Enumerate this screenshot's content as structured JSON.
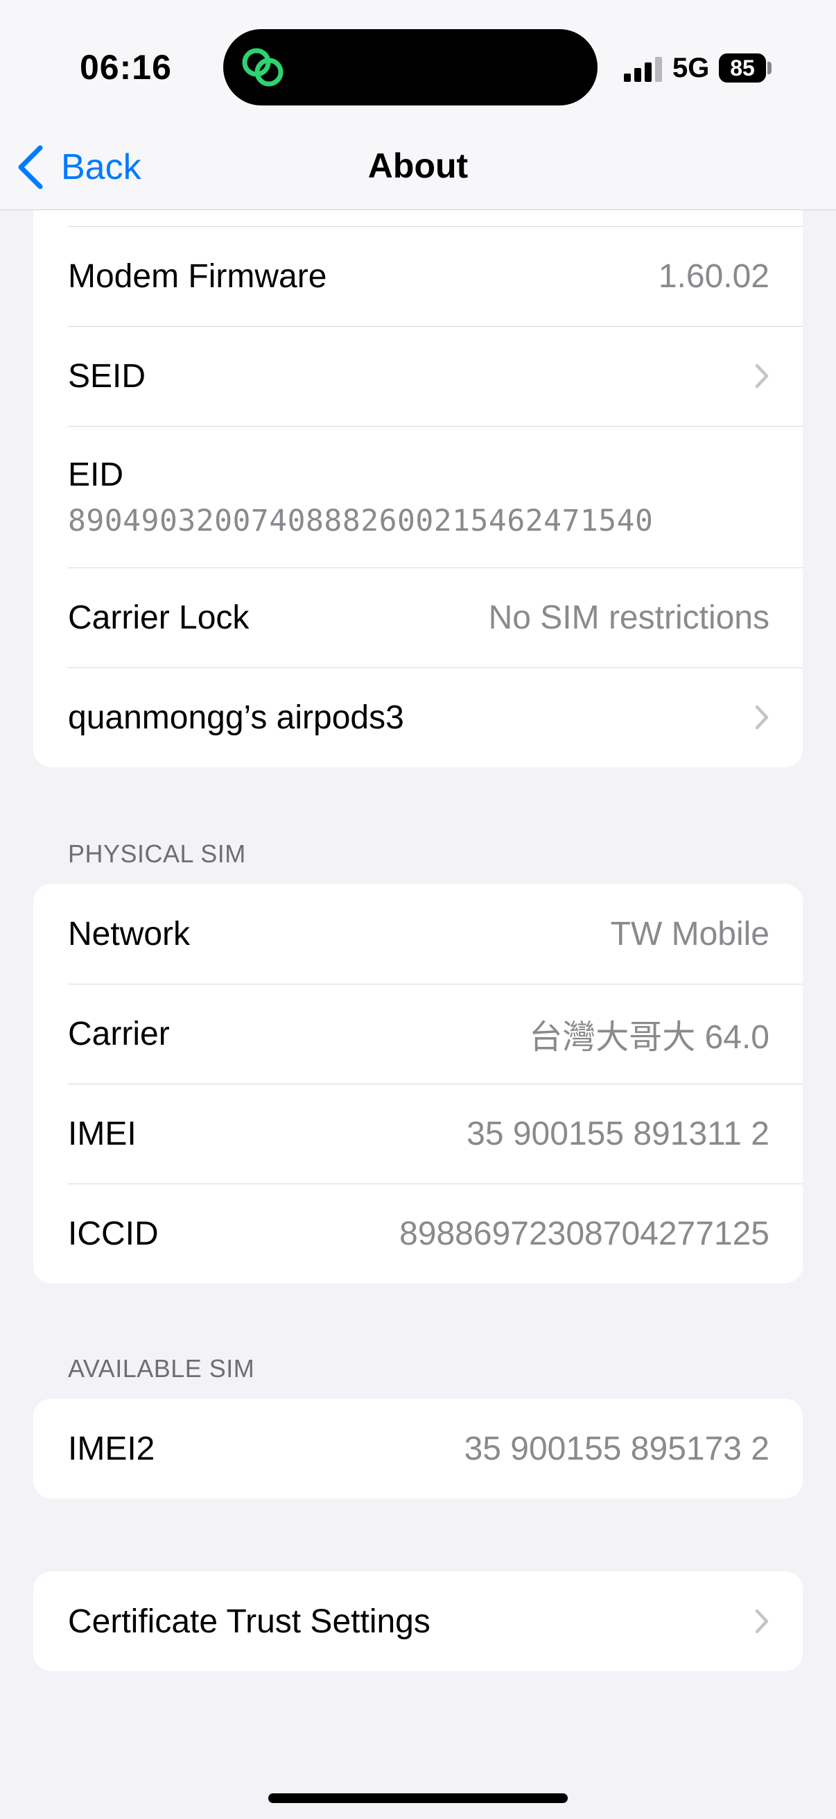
{
  "status_bar": {
    "time": "06:16",
    "network": "5G",
    "battery": "85"
  },
  "nav": {
    "back_label": "Back",
    "title": "About"
  },
  "group_top": {
    "modem_label": "Modem Firmware",
    "modem_value": "1.60.02",
    "seid_label": "SEID",
    "eid_label": "EID",
    "eid_value": "89049032007408882600215462471540",
    "carrier_lock_label": "Carrier Lock",
    "carrier_lock_value": "No SIM restrictions",
    "airpods_label": "quanmongg’s airpods3"
  },
  "physical_sim": {
    "header": "PHYSICAL SIM",
    "network_label": "Network",
    "network_value": "TW Mobile",
    "carrier_label": "Carrier",
    "carrier_value": "台灣大哥大 64.0",
    "imei_label": "IMEI",
    "imei_value": "35 900155 891311 2",
    "iccid_label": "ICCID",
    "iccid_value": "89886972308704277125"
  },
  "available_sim": {
    "header": "AVAILABLE SIM",
    "imei2_label": "IMEI2",
    "imei2_value": "35 900155 895173 2"
  },
  "certificate": {
    "label": "Certificate Trust Settings"
  },
  "colors": {
    "accent": "#007AFF",
    "background": "#F2F2F7",
    "secondary_text": "#8A8A8E"
  }
}
